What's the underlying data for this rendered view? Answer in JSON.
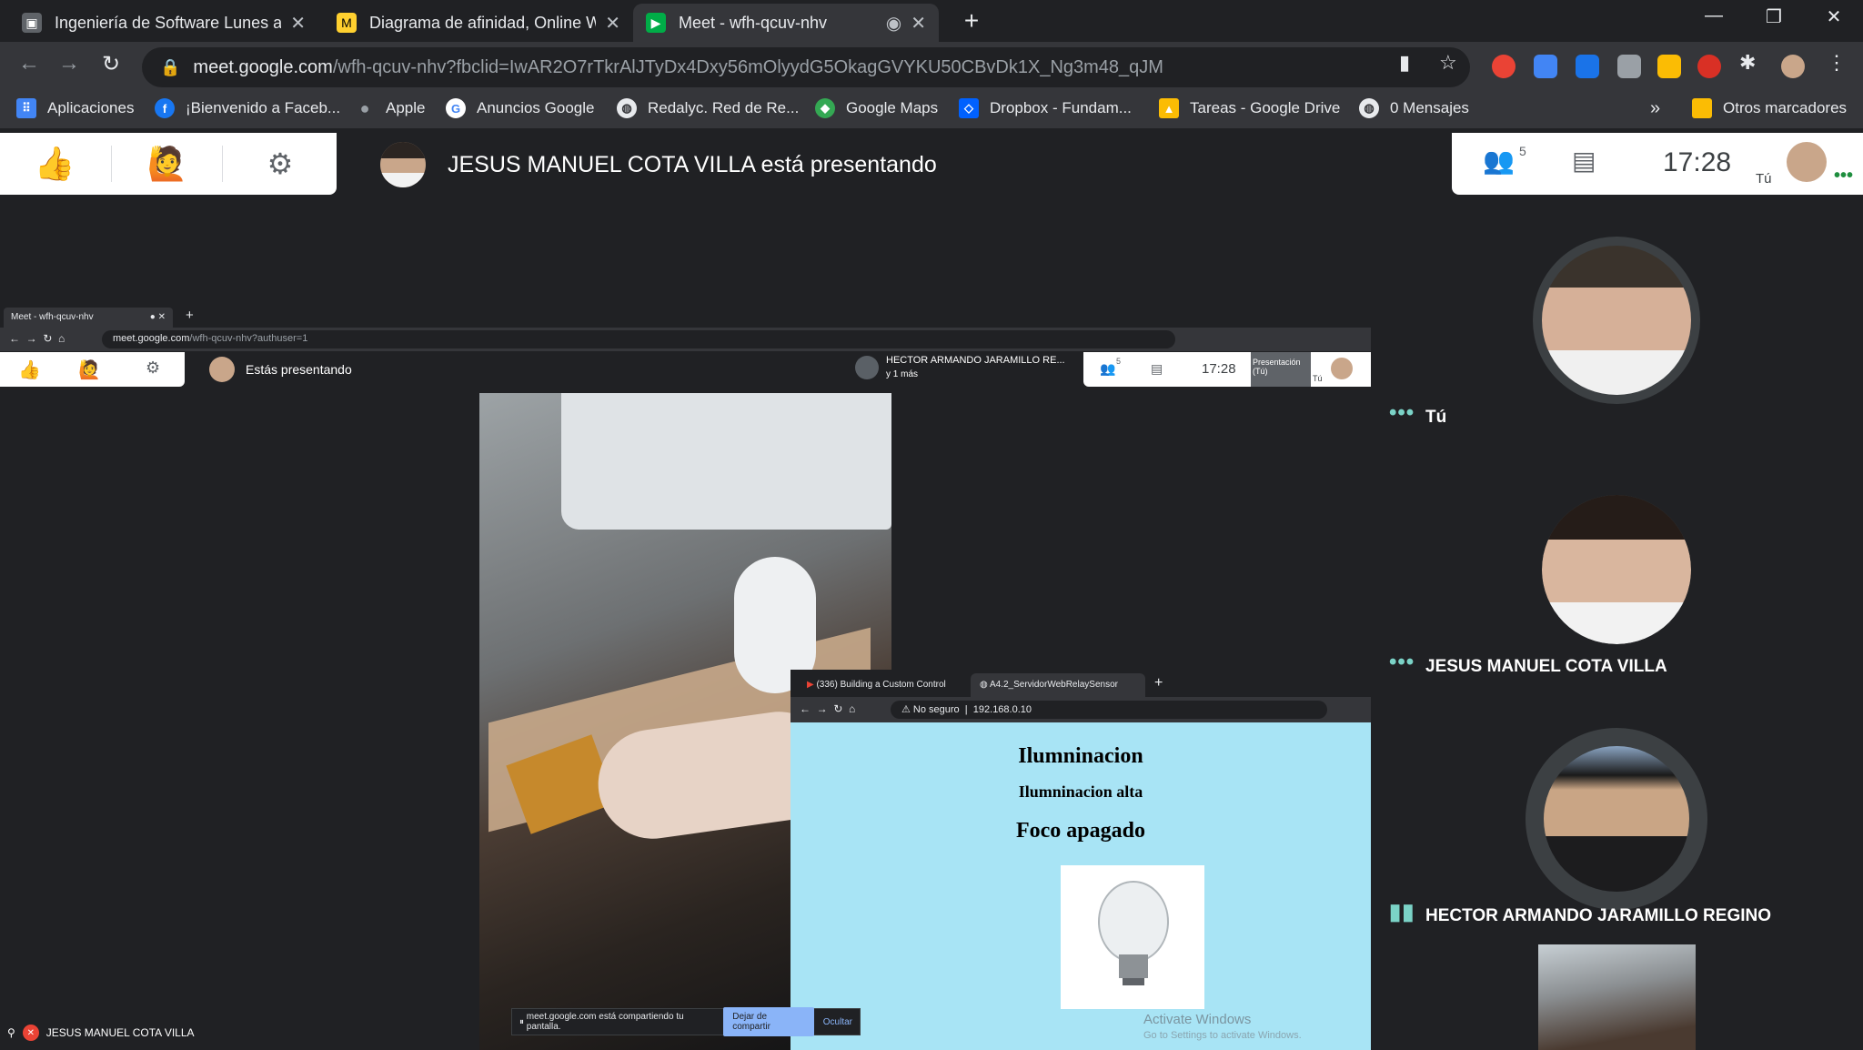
{
  "browser": {
    "tabs": [
      {
        "title": "Ingeniería de Software Lunes a Vi",
        "fav_color": "#5f6368"
      },
      {
        "title": "Diagrama de afinidad, Online Wh",
        "fav_color": "#ffd02f"
      },
      {
        "title": "Meet - wfh-qcuv-nhv",
        "fav_color": "#00ac47"
      }
    ],
    "url_host": "meet.google.com",
    "url_path": "/wfh-qcuv-nhv?fbclid=IwAR2O7rTkrAlJTyDx4Dxy56mOlyydG5OkagGVYKU50CBvDk1X_Ng3m48_qJM",
    "bookmarks": [
      {
        "label": "Aplicaciones",
        "color": "#4285f4"
      },
      {
        "label": "¡Bienvenido a Faceb...",
        "color": "#1877f2"
      },
      {
        "label": "Apple",
        "color": "#5f6368"
      },
      {
        "label": "Anuncios Google",
        "color": "#ffffff"
      },
      {
        "label": "Redalyc. Red de Re...",
        "color": "#5f6368"
      },
      {
        "label": "Google Maps",
        "color": "#34a853"
      },
      {
        "label": "Dropbox - Fundam...",
        "color": "#0061ff"
      },
      {
        "label": "Tareas - Google Drive",
        "color": "#fbbc04"
      },
      {
        "label": "0 Mensajes",
        "color": "#5f6368"
      }
    ],
    "bookmarks_overflow": "»",
    "other_bookmarks": "Otros marcadores"
  },
  "meet": {
    "presenting_banner": "JESUS MANUEL COTA VILLA está presentando",
    "participant_count": "5",
    "clock": "17:28",
    "self_label": "Tú",
    "participants": [
      {
        "name": "Tú"
      },
      {
        "name": "JESUS MANUEL COTA VILLA"
      },
      {
        "name": "HECTOR ARMANDO JARAMILLO REGINO"
      }
    ],
    "presenter_tag": "JESUS MANUEL COTA VILLA"
  },
  "shared_screen": {
    "tab_title": "Meet - wfh-qcuv-nhv",
    "url_host": "meet.google.com",
    "url_path": "/wfh-qcuv-nhv?authuser=1",
    "presenting_text": "Estás presentando",
    "speaker_name": "HECTOR ARMANDO JARAMILLO RE...",
    "speaker_sub": "y 1 más",
    "count": "5",
    "clock": "17:28",
    "presentation_label": "Presentación (Tú)",
    "tu": "Tú",
    "inner_window": {
      "tabs": [
        "(336) Building a Custom Control",
        "A4.2_ServidorWebRelaySensor"
      ],
      "security": "No seguro",
      "url": "192.168.0.10",
      "heading1": "Ilumninacion",
      "heading2": "Ilumninacion alta",
      "heading3": "Foco apagado",
      "watermark1": "Activate Windows",
      "watermark2": "Go to Settings to activate Windows."
    },
    "sharing_notice": "meet.google.com está compartiendo tu pantalla.",
    "stop_sharing": "Dejar de compartir",
    "hide": "Ocultar"
  }
}
